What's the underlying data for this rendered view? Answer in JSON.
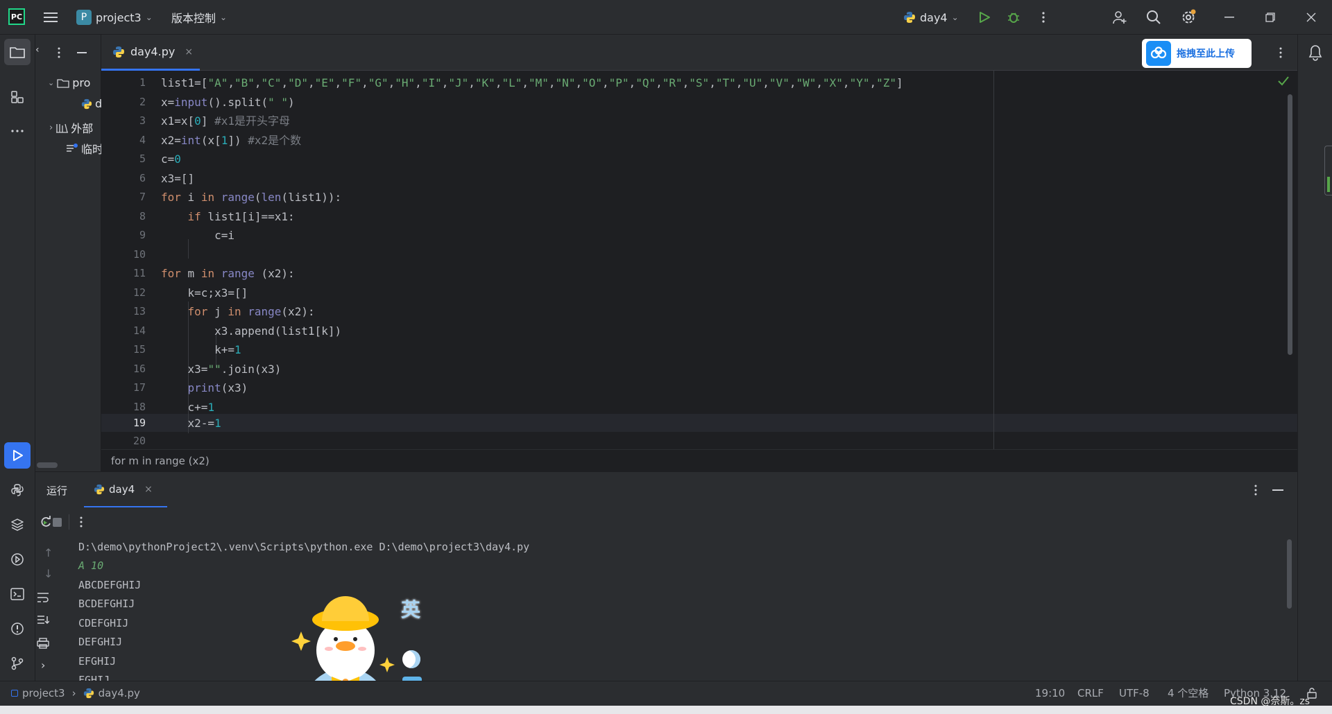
{
  "titlebar": {
    "project_name": "project3",
    "project_badge": "P",
    "vcs_label": "版本控制",
    "run_config": "day4"
  },
  "project_panel": {
    "items": [
      {
        "label": "pro"
      },
      {
        "label": "d"
      },
      {
        "label": "外部"
      },
      {
        "label": "临时"
      }
    ]
  },
  "editor": {
    "tab_label": "day4.py",
    "upload_button": "拖拽至此上传",
    "line_numbers": [
      "1",
      "2",
      "3",
      "4",
      "5",
      "6",
      "7",
      "8",
      "9",
      "10",
      "11",
      "12",
      "13",
      "14",
      "15",
      "16",
      "17",
      "18",
      "19",
      "20"
    ],
    "breadcrumb": "for m in range (x2)"
  },
  "run_panel": {
    "tab_run": "运行",
    "tab_config": "day4",
    "output": [
      "D:\\demo\\pythonProject2\\.venv\\Scripts\\python.exe D:\\demo\\project3\\day4.py",
      "A 10",
      "ABCDEFGHIJ",
      "BCDEFGHIJ",
      "CDEFGHIJ",
      "DEFGHIJ",
      "EFGHIJ",
      "FGHIJ"
    ]
  },
  "sticker": {
    "text": "英"
  },
  "statusbar": {
    "project": "project3",
    "file": "day4.py",
    "position": "19:10",
    "line_sep": "CRLF",
    "encoding": "UTF-8",
    "indent": "4 个空格",
    "interpreter": "Python 3.12",
    "watermark": "CSDN @奈斯。zs"
  },
  "colors": {
    "accent": "#3574f0",
    "background": "#1e1f22",
    "panel": "#2b2d30"
  }
}
